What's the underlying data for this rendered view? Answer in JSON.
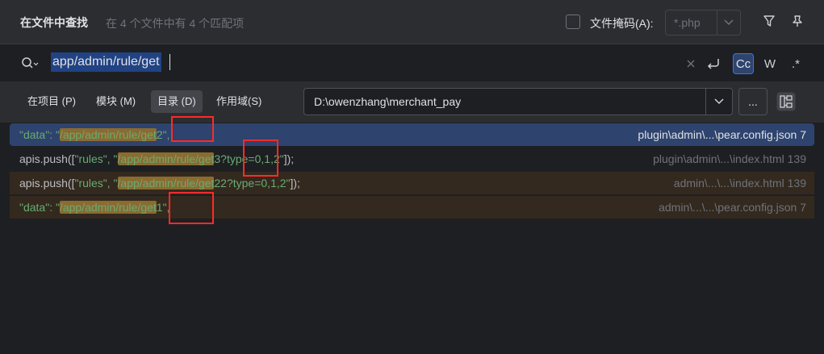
{
  "header": {
    "title": "在文件中查找",
    "subtitle": "在 4 个文件中有 4 个匹配项",
    "file_mask_label": "文件掩码(A):",
    "file_mask_value": "*.php"
  },
  "search": {
    "query": "app/admin/rule/get"
  },
  "scope": {
    "tabs": [
      {
        "label": "在项目 (P)"
      },
      {
        "label": "模块 (M)"
      },
      {
        "label": "目录 (D)"
      },
      {
        "label": "作用域(S)"
      }
    ],
    "directory": "D:\\owenzhang\\merchant_pay",
    "browse_label": "..."
  },
  "results": [
    {
      "pre": "\"data\": \"",
      "pre_cls": "str",
      "q": "/app/admin/rule/get",
      "post": "2\",",
      "post_cls": "str",
      "path": "plugin\\admin\\...\\pear.config.json 7"
    },
    {
      "pre": "apis.push([",
      "pre_cls": "plain",
      "pre2": "\"rules\", \"",
      "q": "/app/admin/rule/get",
      "post": "3?type=0,1,2\"",
      "post2": "]);",
      "path": "plugin\\admin\\...\\index.html 139"
    },
    {
      "pre": "apis.push([",
      "pre_cls": "plain",
      "pre2": "\"rules\", \"",
      "q": "/app/admin/rule/get",
      "post": "22?type=0,1,2\"",
      "post2": "]);",
      "path": "admin\\...\\...\\index.html 139"
    },
    {
      "pre": "\"data\": \"",
      "pre_cls": "str",
      "q": "/app/admin/rule/get",
      "post": "1\",",
      "post_cls": "str",
      "path": "admin\\...\\...\\pear.config.json 7"
    }
  ],
  "colors": {
    "selection": "#2e436e",
    "match": "#8a6b30",
    "annotation": "#ff2a2a"
  }
}
